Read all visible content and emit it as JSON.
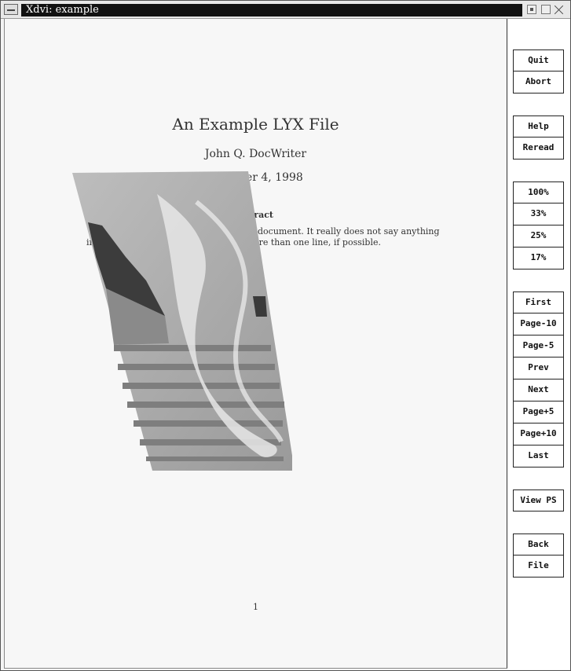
{
  "window": {
    "title": "Xdvi:  example"
  },
  "document": {
    "title": "An Example LYX File",
    "author": "John Q. DocWriter",
    "date_visible": "ber 4, 1998",
    "abstract_heading_visible": "stract",
    "abstract_line1_visible": "e document.  It really does not say anything",
    "abstract_line2_visible": "in                                                    o more than one line, if possible.",
    "page_number": "1"
  },
  "sidebar": {
    "buttons": [
      "Quit",
      "Abort",
      "Help",
      "Reread",
      "100%",
      "33%",
      "25%",
      "17%",
      "First",
      "Page-10",
      "Page-5",
      "Prev",
      "Next",
      "Page+5",
      "Page+10",
      "Last",
      "View PS",
      "Back",
      "File"
    ]
  }
}
